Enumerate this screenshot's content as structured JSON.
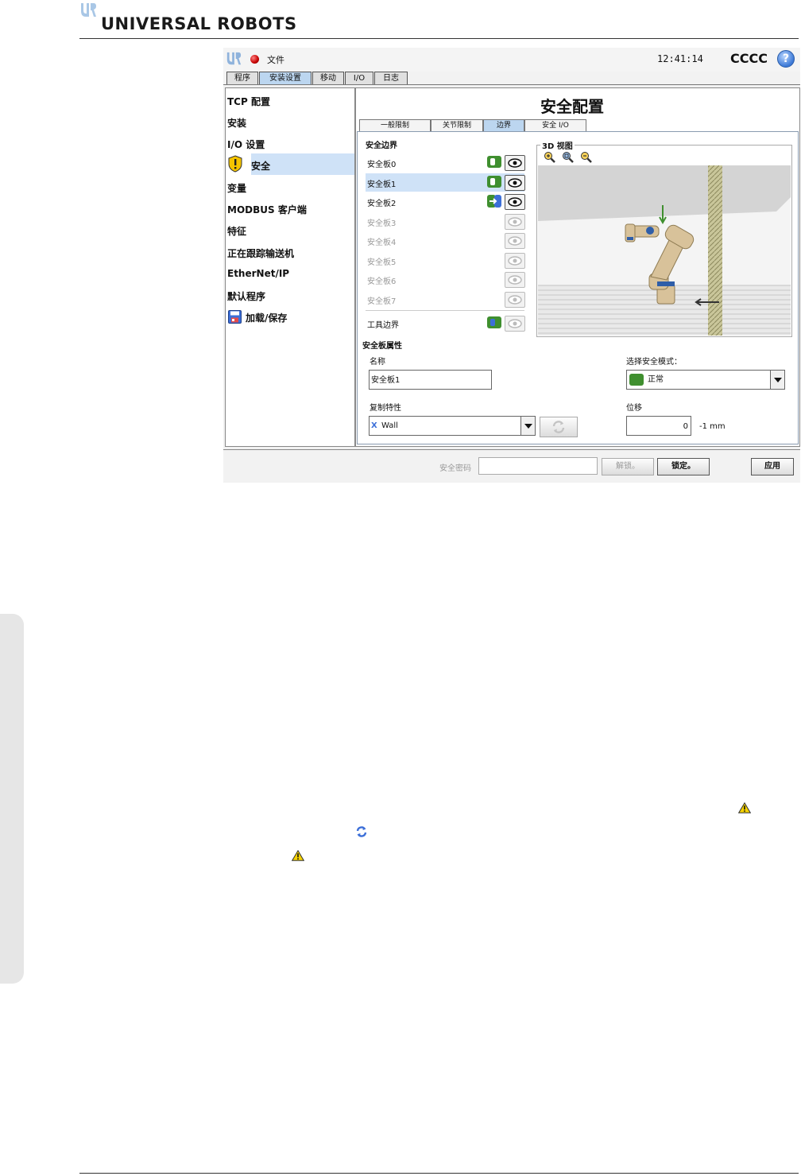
{
  "page": {
    "brand": "UNIVERSAL ROBOTS"
  },
  "app": {
    "file_menu": "文件",
    "clock": "12:41:14",
    "robot_name": "CCCC",
    "help_glyph": "?",
    "main_tabs": [
      "程序",
      "安装设置",
      "移动",
      "I/O",
      "日志"
    ],
    "active_main_tab": "安装设置",
    "sidebar": {
      "items": [
        "TCP 配置",
        "安装",
        "I/O 设置",
        "安全",
        "变量",
        "MODBUS 客户端",
        "特征",
        "正在跟踪输送机",
        "EtherNet/IP",
        "默认程序",
        "加载/保存"
      ],
      "selected": "安全"
    },
    "content": {
      "title": "安全配置",
      "sub_tabs": [
        "一般限制",
        "关节限制",
        "边界",
        "安全 I/O"
      ],
      "active_sub_tab": "边界",
      "safety_boundaries_label": "安全边界",
      "planes": [
        {
          "name": "安全板0",
          "enabled": true,
          "visible": true
        },
        {
          "name": "安全板1",
          "enabled": true,
          "visible": true,
          "selected": true
        },
        {
          "name": "安全板2",
          "enabled": true,
          "visible": true,
          "mode_icon": "trigger-icon"
        },
        {
          "name": "安全板3",
          "enabled": false,
          "visible": false
        },
        {
          "name": "安全板4",
          "enabled": false,
          "visible": false
        },
        {
          "name": "安全板5",
          "enabled": false,
          "visible": false
        },
        {
          "name": "安全板6",
          "enabled": false,
          "visible": false
        },
        {
          "name": "安全板7",
          "enabled": false,
          "visible": false
        }
      ],
      "tool_boundary_label": "工具边界",
      "view3d_label": "3D 视图",
      "plane_props_label": "安全板属性",
      "name_label": "名称",
      "name_value": "安全板1",
      "mode_label": "选择安全模式：",
      "mode_value": "正常",
      "copy_label": "复制特性",
      "copy_value": "Wall",
      "displacement_label": "位移",
      "displacement_value": "0",
      "displacement_unit": "-1 mm"
    },
    "bottom": {
      "password_label": "安全密码",
      "password_value": "",
      "unlock_label": "解锁。",
      "lock_label": "锁定。",
      "apply_label": "应用"
    }
  },
  "colors": {
    "accent_green": "#3f8f2f",
    "selection_blue": "#cfe2f7",
    "tab_active": "#bcd6f0"
  }
}
